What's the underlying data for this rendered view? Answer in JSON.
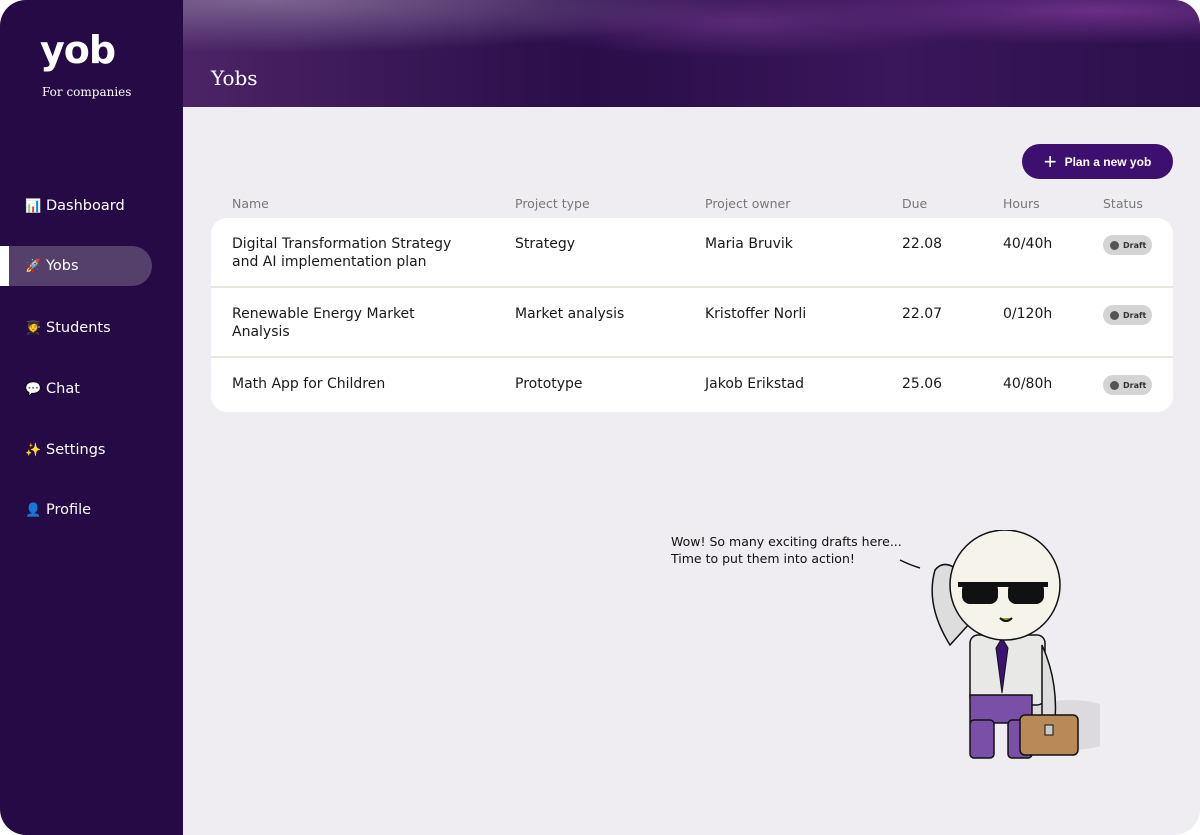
{
  "brand": {
    "logo": "yob",
    "tagline": "For companies"
  },
  "sidebar": {
    "items": [
      {
        "icon": "📊",
        "label": "Dashboard",
        "active": false
      },
      {
        "icon": "🚀",
        "label": "Yobs",
        "active": true
      },
      {
        "icon": "🧑‍🎓",
        "label": "Students",
        "active": false
      },
      {
        "icon": "💬",
        "label": "Chat",
        "active": false
      },
      {
        "icon": "✨",
        "label": "Settings",
        "active": false
      },
      {
        "icon": "👤",
        "label": "Profile",
        "active": false
      }
    ]
  },
  "header": {
    "title": "Yobs"
  },
  "toolbar": {
    "new_label": "Plan a new yob"
  },
  "table": {
    "headers": [
      "Name",
      "Project type",
      "Project owner",
      "Due",
      "Hours",
      "Status"
    ],
    "rows": [
      {
        "name": "Digital Transformation Strategy and AI implementation plan",
        "type": "Strategy",
        "owner": "Maria Bruvik",
        "due": "22.08",
        "hours": "40/40h",
        "status": "Draft"
      },
      {
        "name": "Renewable Energy Market Analysis",
        "type": "Market analysis",
        "owner": "Kristoffer Norli",
        "due": "22.07",
        "hours": "0/120h",
        "status": "Draft"
      },
      {
        "name": "Math App for Children",
        "type": "Prototype",
        "owner": "Jakob Erikstad",
        "due": "25.06",
        "hours": "40/80h",
        "status": "Draft"
      }
    ]
  },
  "mascot": {
    "line1": "Wow! So many exciting drafts here...",
    "line2": "Time to put them into action!"
  }
}
